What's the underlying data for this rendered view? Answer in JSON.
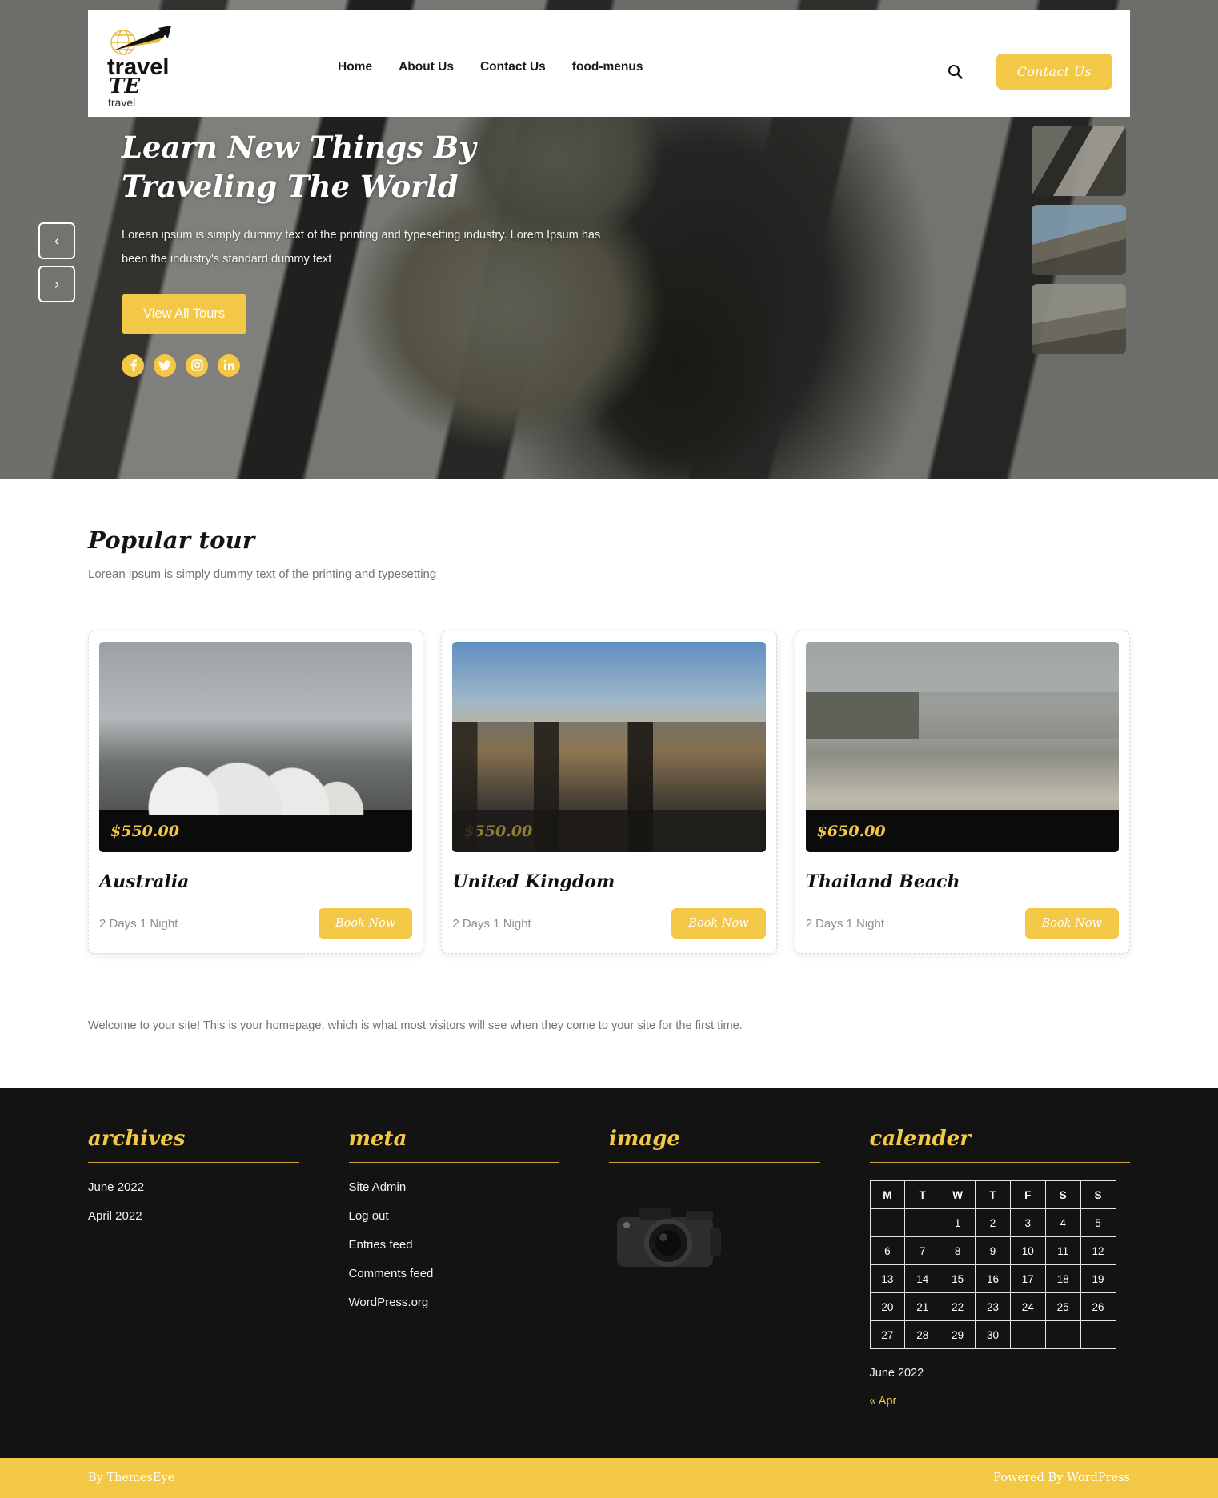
{
  "theme": {
    "accent": "#f3c846",
    "dark": "#131313",
    "price_color": "#f3c846"
  },
  "header": {
    "brand_word1": "travel",
    "brand_word2": "TE",
    "brand_sub": "travel",
    "nav": [
      {
        "label": "Home"
      },
      {
        "label": "About Us"
      },
      {
        "label": "Contact Us"
      },
      {
        "label": "food-menus"
      }
    ],
    "search_icon": "search-icon",
    "contact_button": "Contact Us"
  },
  "hero": {
    "title": "Learn New Things By Traveling The World",
    "description": "Lorean ipsum is simply dummy text of the printing and typesetting industry. Lorem Ipsum has been the industry's standard dummy text",
    "cta": "View All Tours",
    "socials": [
      {
        "name": "facebook-icon",
        "glyph": "f"
      },
      {
        "name": "twitter-icon",
        "glyph": "t"
      },
      {
        "name": "instagram-icon",
        "glyph": "i"
      },
      {
        "name": "linkedin-icon",
        "glyph": "in"
      }
    ],
    "prev_arrow": "‹",
    "next_arrow": "›"
  },
  "popular": {
    "title": "Popular tour",
    "subtitle": "Lorean ipsum is simply dummy text of the printing and typesetting",
    "cards": [
      {
        "price": "$550.00",
        "name": "Australia",
        "duration": "2 Days 1 Night",
        "button": "Book Now"
      },
      {
        "price": "$550.00",
        "name": "United Kingdom",
        "duration": "2 Days 1 Night",
        "button": "Book Now"
      },
      {
        "price": "$650.00",
        "name": "Thailand Beach",
        "duration": "2 Days 1 Night",
        "button": "Book Now"
      }
    ]
  },
  "welcome_text": "Welcome to your site! This is your homepage, which is what most visitors will see when they come to your site for the first time.",
  "footer": {
    "archives": {
      "title": "archives",
      "links": [
        {
          "label": "June 2022"
        },
        {
          "label": "April 2022"
        }
      ]
    },
    "meta": {
      "title": "meta",
      "links": [
        {
          "label": "Site Admin"
        },
        {
          "label": "Log out"
        },
        {
          "label": "Entries feed"
        },
        {
          "label": "Comments feed"
        },
        {
          "label": "WordPress.org"
        }
      ]
    },
    "image": {
      "title": "image",
      "icon": "camera-icon"
    },
    "calendar": {
      "title": "calender",
      "day_headers": [
        "M",
        "T",
        "W",
        "T",
        "F",
        "S",
        "S"
      ],
      "weeks": [
        [
          "",
          "",
          "1",
          "2",
          "3",
          "4",
          "5"
        ],
        [
          "6",
          "7",
          "8",
          "9",
          "10",
          "11",
          "12"
        ],
        [
          "13",
          "14",
          "15",
          "16",
          "17",
          "18",
          "19"
        ],
        [
          "20",
          "21",
          "22",
          "23",
          "24",
          "25",
          "26"
        ],
        [
          "27",
          "28",
          "29",
          "30",
          "",
          "",
          ""
        ]
      ],
      "caption": "June 2022",
      "prev_label": "« Apr"
    }
  },
  "bottombar": {
    "left": "By ThemesEye",
    "right": "Powered By WordPress"
  }
}
